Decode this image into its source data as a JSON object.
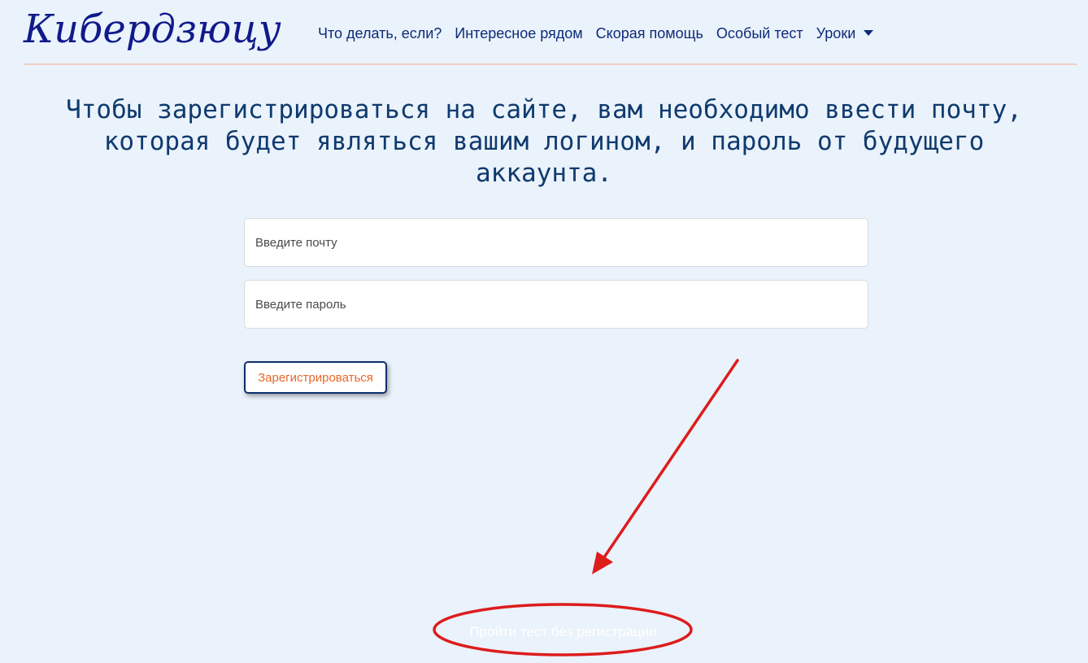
{
  "header": {
    "brand": "Кибердзюцу",
    "nav": [
      "Что делать, если?",
      "Интересное рядом",
      "Скорая помощь",
      "Особый тест",
      "Уроки"
    ]
  },
  "main": {
    "headline": "Чтобы зарегистрироваться на сайте, вам необходимо ввести почту, которая будет являться вашим логином, и пароль от будущего аккаунта.",
    "email_placeholder": "Введите почту",
    "password_placeholder": "Введите пароль",
    "register_label": "Зарегистрироваться",
    "skip_label": "Пройти тест без регистрации"
  },
  "colors": {
    "background": "#eaf2fb",
    "brand": "#101a8a",
    "nav_text": "#0d2b78",
    "headline": "#0f3a6e",
    "button_text": "#e8682a",
    "button_border": "#0d2f6b",
    "annotation": "#dd1c1c"
  },
  "icons": {
    "dropdown": "chevron-down-icon",
    "annotation_arrow": "red-arrow",
    "annotation_ellipse": "red-ellipse"
  }
}
